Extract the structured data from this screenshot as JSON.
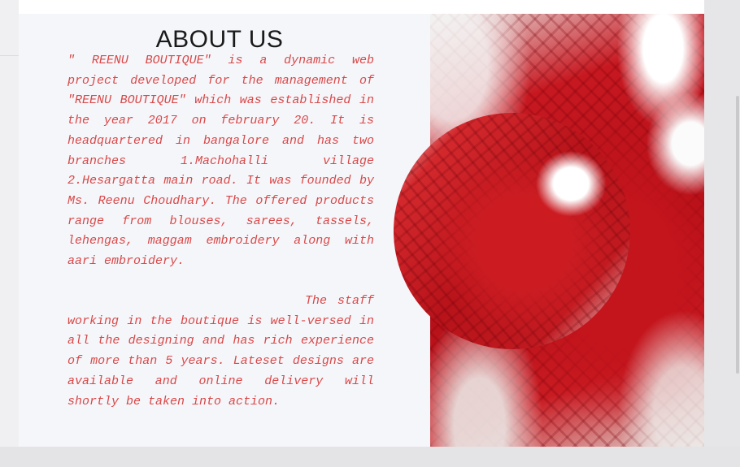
{
  "about": {
    "title": "ABOUT US",
    "paragraph1": "\" REENU BOUTIQUE\" is a dynamic web project developed for the management of \"REENU BOUTIQUE\" which was established in the year 2017 on february 20. It is headquartered in bangalore and has two branches 1.Machohalli village 2.Hesargatta main road. It was founded by Ms. Reenu Choudhary. The offered products range from blouses, sarees, tassels, lehengas, maggam embroidery along with aari embroidery.",
    "paragraph2": "The staff working in the boutique is well-versed in all the designing and has rich experience of more than 5 years. Lateset designs are available and online delivery will shortly be taken into action."
  },
  "colors": {
    "text_accent": "#d94848",
    "card_background": "#f5f6fa"
  }
}
